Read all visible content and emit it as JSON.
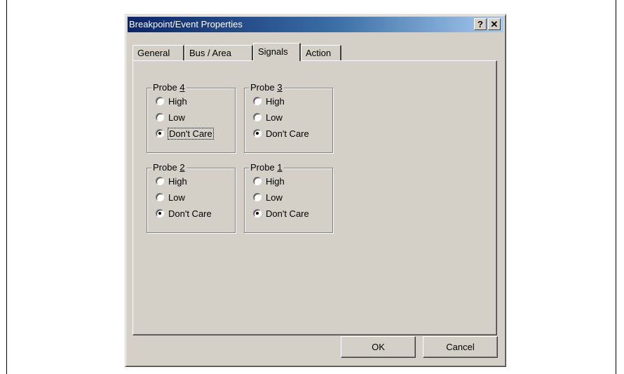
{
  "dialog": {
    "title": "Breakpoint/Event Properties",
    "help_label": "?",
    "close_label": "✕"
  },
  "tabs": [
    {
      "label": "General",
      "active": false
    },
    {
      "label": "Bus / Area",
      "active": false
    },
    {
      "label": "Signals",
      "active": true
    },
    {
      "label": "Action",
      "active": false
    }
  ],
  "groups": [
    {
      "label": "Probe 4",
      "options": [
        "High",
        "Low",
        "Don't Care"
      ],
      "selected": "Don't Care"
    },
    {
      "label": "Probe 3",
      "options": [
        "High",
        "Low",
        "Don't Care"
      ],
      "selected": "Don't Care"
    },
    {
      "label": "Probe 2",
      "options": [
        "High",
        "Low",
        "Don't Care"
      ],
      "selected": "Don't Care"
    },
    {
      "label": "Probe 1",
      "options": [
        "High",
        "Low",
        "Don't Care"
      ],
      "selected": "Don't Care"
    }
  ],
  "buttons": {
    "ok": "OK",
    "cancel": "Cancel"
  },
  "colors": {
    "face": "#d4d0c8",
    "title_start": "#0a246a",
    "title_end": "#a6caf0"
  }
}
